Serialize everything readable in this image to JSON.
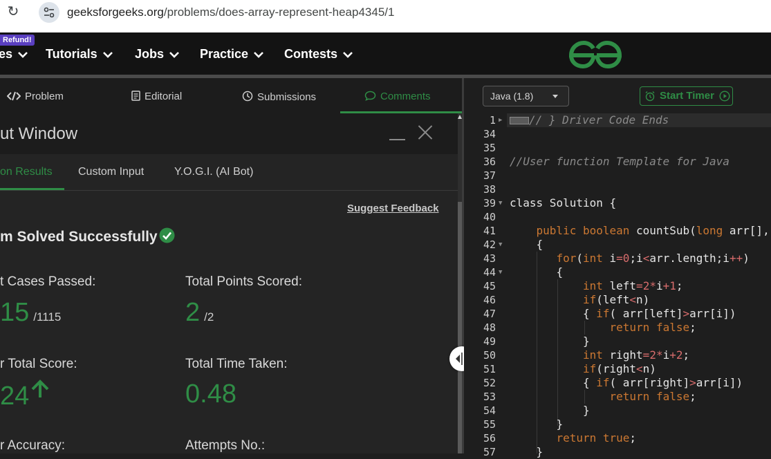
{
  "browser": {
    "url_host": "geeksforgeeks.org",
    "url_path": "/problems/does-array-represent-heap4345/1"
  },
  "nav": {
    "badge": "Refund!",
    "items": [
      "es",
      "Tutorials",
      "Jobs",
      "Practice",
      "Contests"
    ]
  },
  "problem_tabs": [
    "Problem",
    "Editorial",
    "Submissions",
    "Comments"
  ],
  "output_window": {
    "title": "ut Window",
    "subtabs": [
      "on Results",
      "Custom Input",
      "Y.O.G.I. (AI Bot)"
    ],
    "suggest_feedback": "Suggest Feedback",
    "solved_text": "m Solved Successfully",
    "stats": {
      "test_cases_label": "t Cases Passed:",
      "test_cases_value": "15",
      "test_cases_total": "/1115",
      "points_label": "Total Points Scored:",
      "points_value": "2",
      "points_total": "/2",
      "score_label": "r Total Score:",
      "score_value": "24",
      "time_label": "Total Time Taken:",
      "time_value": "0.48",
      "accuracy_label": "r Accuracy:",
      "attempts_label": "Attempts No.:"
    }
  },
  "editor": {
    "language": "Java (1.8)",
    "timer_label": "Start Timer",
    "line_numbers": [
      "1",
      "34",
      "35",
      "36",
      "37",
      "38",
      "39",
      "40",
      "41",
      "42",
      "43",
      "44",
      "45",
      "46",
      "47",
      "48",
      "49",
      "50",
      "51",
      "52",
      "53",
      "54",
      "55",
      "56",
      "57"
    ],
    "code": {
      "l1": "// } Driver Code Ends",
      "l36": "//User function Template for Java",
      "l39_kw": "class",
      "l39_rest": " Solution {",
      "l41_kw1": "public",
      "l41_kw2": "boolean",
      "l41_fn": " countSub(",
      "l41_kw3": "long",
      "l41_rest": " arr[],",
      "l42": "{",
      "l43_kw1": "for",
      "l43_p1": "(",
      "l43_kw2": "int",
      "l43_p2": " i",
      "l43_op1": "=",
      "l43_n1": "0",
      "l43_p3": ";i",
      "l43_op2": "<",
      "l43_p4": "arr.length;i",
      "l43_op3": "++",
      "l43_p5": ")",
      "l44": "{",
      "l45_kw": "int",
      "l45_p1": " left",
      "l45_op1": "=",
      "l45_n1": "2",
      "l45_op2": "*",
      "l45_p2": "i",
      "l45_op3": "+",
      "l45_n2": "1",
      "l45_p3": ";",
      "l46_kw": "if",
      "l46_p1": "(left",
      "l46_op": "<",
      "l46_p2": "n)",
      "l47_p1": "{ ",
      "l47_kw": "if",
      "l47_p2": "( arr[left]",
      "l47_op": ">",
      "l47_p3": "arr[i])",
      "l48_kw1": "return",
      "l48_kw2": "false",
      "l48_p": ";",
      "l49": "}",
      "l50_kw": "int",
      "l50_p1": " right",
      "l50_op1": "=",
      "l50_n1": "2",
      "l50_op2": "*",
      "l50_p2": "i",
      "l50_op3": "+",
      "l50_n2": "2",
      "l50_p3": ";",
      "l51_kw": "if",
      "l51_p1": "(right",
      "l51_op": "<",
      "l51_p2": "n)",
      "l52_p1": "{ ",
      "l52_kw": "if",
      "l52_p2": "( arr[right]",
      "l52_op": ">",
      "l52_p3": "arr[i])",
      "l53_kw1": "return",
      "l53_kw2": "false",
      "l53_p": ";",
      "l54": "}",
      "l55": "}",
      "l56_kw1": "return",
      "l56_kw2": "true",
      "l56_p": ";",
      "l57": "}"
    }
  },
  "colors": {
    "accent": "#2f8d46",
    "keyword": "#cc7832",
    "number": "#d86c6c",
    "comment": "#8a8a8a"
  }
}
